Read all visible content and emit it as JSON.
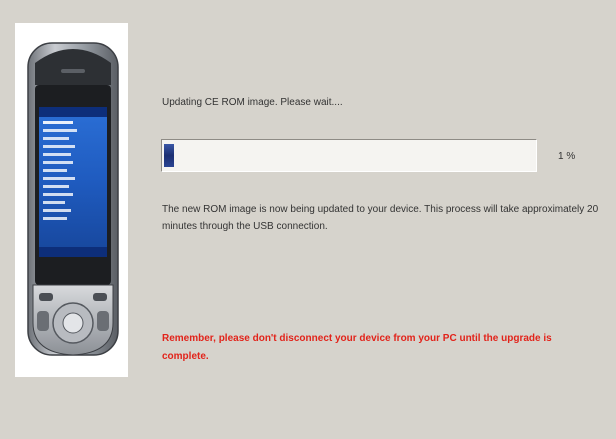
{
  "status_text": "Updating CE ROM image. Please wait....",
  "progress": {
    "percent": 1,
    "label": "1 %"
  },
  "info_text": "The new ROM image is now being updated to your device. This process will take approximately 20 minutes through the USB connection.",
  "warning_text": "Remember, please don't disconnect your device from your PC until the upgrade is complete.",
  "colors": {
    "progress_fill": "#1c2f72",
    "warning": "#e2231a",
    "background": "#d6d3cc"
  },
  "device_image": {
    "icon": "smartphone-icon"
  }
}
